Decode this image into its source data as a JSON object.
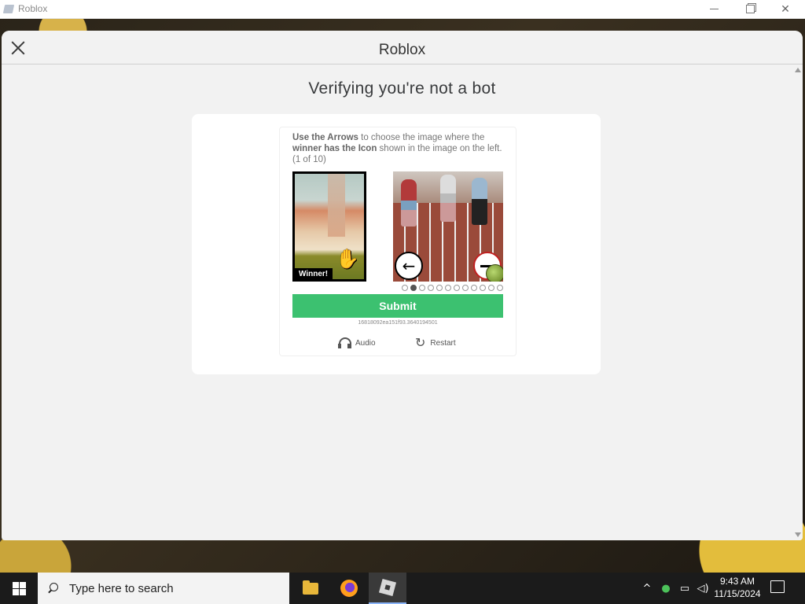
{
  "window": {
    "title": "Roblox"
  },
  "modal": {
    "title": "Roblox",
    "heading": "Verifying you're not a bot"
  },
  "captcha": {
    "instruction_bold1": "Use the Arrows",
    "instruction_text1": " to choose the image where the ",
    "instruction_bold2": "winner has the Icon",
    "instruction_text2": " shown in the image on the left. (1 of 10)",
    "reference_tag": "Winner!",
    "left_arrow": "←",
    "page_dots_total": 12,
    "page_dots_active": 2,
    "submit_label": "Submit",
    "session_id": "16818092ea151f93.3640194501",
    "audio_label": "Audio",
    "restart_label": "Restart",
    "submit_color": "#3cc170"
  },
  "taskbar": {
    "search_placeholder": "Type here to search",
    "apps": [
      "file-explorer",
      "firefox",
      "roblox"
    ],
    "time": "9:43 AM",
    "date": "11/15/2024"
  }
}
